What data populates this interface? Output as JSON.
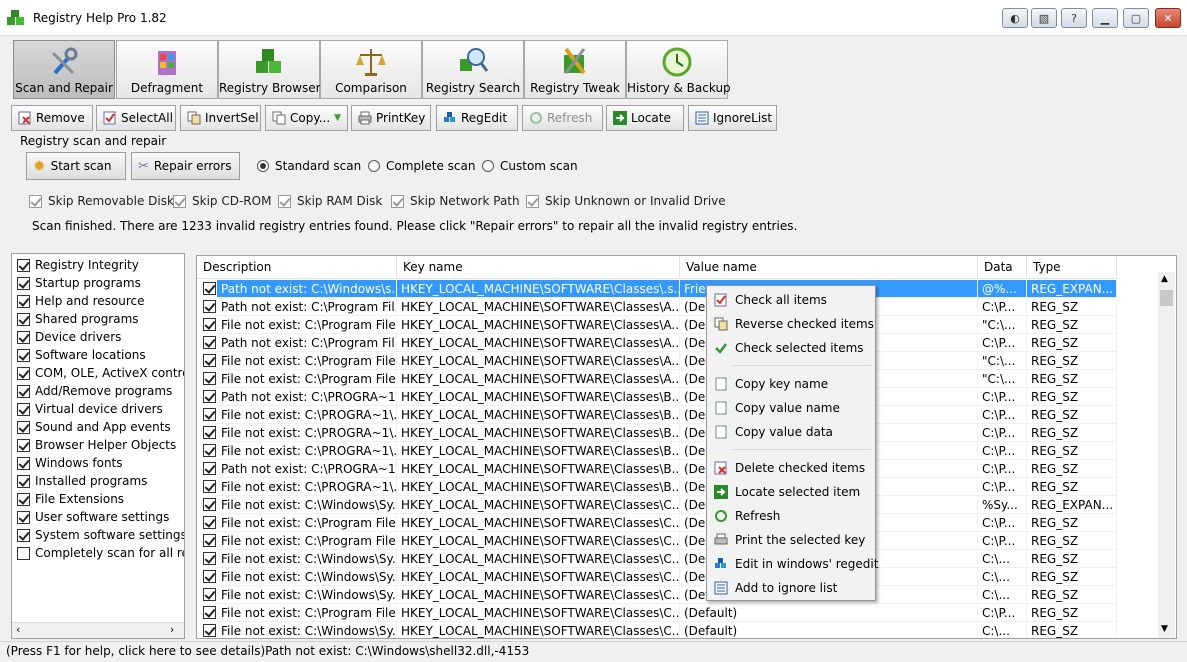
{
  "window": {
    "title": "Registry Help Pro 1.82"
  },
  "main_tabs": [
    {
      "label": "Scan and Repair",
      "icon": "scan-repair-icon",
      "active": true
    },
    {
      "label": "Defragment",
      "icon": "defragment-icon"
    },
    {
      "label": "Registry Browser",
      "icon": "registry-browser-icon"
    },
    {
      "label": "Comparison",
      "icon": "comparison-icon"
    },
    {
      "label": "Registry Search",
      "icon": "registry-search-icon"
    },
    {
      "label": "Registry Tweak",
      "icon": "registry-tweak-icon"
    },
    {
      "label": "History & Backup",
      "icon": "history-backup-icon"
    }
  ],
  "toolbar": {
    "remove": "Remove",
    "selectall": "SelectAll",
    "invertsel": "InvertSel",
    "copy": "Copy...",
    "printkey": "PrintKey",
    "regedit": "RegEdit",
    "refresh": "Refresh",
    "locate": "Locate",
    "ignorelist": "IgnoreList"
  },
  "scan": {
    "group_label": "Registry scan and repair",
    "start_label": "Start scan",
    "repair_label": "Repair errors",
    "modes": [
      "Standard scan",
      "Complete scan",
      "Custom scan"
    ],
    "selected_mode": "Standard scan",
    "skips": [
      "Skip Removable Disk",
      "Skip CD-ROM",
      "Skip RAM Disk",
      "Skip Network Path",
      "Skip Unknown or Invalid Drive"
    ],
    "status": "Scan finished. There are 1233 invalid registry entries found. Please click \"Repair errors\" to repair all the invalid registry entries."
  },
  "categories": [
    {
      "label": "Registry Integrity",
      "checked": true
    },
    {
      "label": "Startup programs",
      "checked": true
    },
    {
      "label": "Help and resource",
      "checked": true
    },
    {
      "label": "Shared programs",
      "checked": true
    },
    {
      "label": "Device drivers",
      "checked": true
    },
    {
      "label": "Software locations",
      "checked": true
    },
    {
      "label": "COM, OLE, ActiveX control",
      "checked": true
    },
    {
      "label": "Add/Remove programs",
      "checked": true
    },
    {
      "label": "Virtual device drivers",
      "checked": true
    },
    {
      "label": "Sound and App events",
      "checked": true
    },
    {
      "label": "Browser Helper Objects",
      "checked": true
    },
    {
      "label": "Windows fonts",
      "checked": true
    },
    {
      "label": "Installed programs",
      "checked": true
    },
    {
      "label": "File Extensions",
      "checked": true
    },
    {
      "label": "User software settings",
      "checked": true
    },
    {
      "label": "System software settings",
      "checked": true
    },
    {
      "label": "Completely scan for all regis",
      "checked": false
    }
  ],
  "grid": {
    "columns": [
      "Description",
      "Key name",
      "Value name",
      "Data",
      "Type"
    ],
    "rows": [
      [
        "Path not exist: C:\\Windows\\s...",
        "HKEY_LOCAL_MACHINE\\SOFTWARE\\Classes\\.s...",
        "Frie",
        "@%...",
        "REG_EXPAN..."
      ],
      [
        "Path not exist: C:\\Program Fil...",
        "HKEY_LOCAL_MACHINE\\SOFTWARE\\Classes\\A...",
        "(De",
        "C:\\P...",
        "REG_SZ"
      ],
      [
        "File not exist: C:\\Program Files...",
        "HKEY_LOCAL_MACHINE\\SOFTWARE\\Classes\\A...",
        "(De",
        "\"C:\\...",
        "REG_SZ"
      ],
      [
        "Path not exist: C:\\Program Fil...",
        "HKEY_LOCAL_MACHINE\\SOFTWARE\\Classes\\A...",
        "(De",
        "C:\\P...",
        "REG_SZ"
      ],
      [
        "File not exist: C:\\Program Files...",
        "HKEY_LOCAL_MACHINE\\SOFTWARE\\Classes\\A...",
        "(De",
        "\"C:\\...",
        "REG_SZ"
      ],
      [
        "File not exist: C:\\Program Files...",
        "HKEY_LOCAL_MACHINE\\SOFTWARE\\Classes\\A...",
        "(De",
        "\"C:\\...",
        "REG_SZ"
      ],
      [
        "Path not exist: C:\\PROGRA~1\\...",
        "HKEY_LOCAL_MACHINE\\SOFTWARE\\Classes\\B...",
        "(De",
        "C:\\P...",
        "REG_SZ"
      ],
      [
        "File not exist: C:\\PROGRA~1\\...",
        "HKEY_LOCAL_MACHINE\\SOFTWARE\\Classes\\B...",
        "(De",
        "C:\\P...",
        "REG_SZ"
      ],
      [
        "File not exist: C:\\PROGRA~1\\...",
        "HKEY_LOCAL_MACHINE\\SOFTWARE\\Classes\\B...",
        "(De",
        "C:\\P...",
        "REG_SZ"
      ],
      [
        "File not exist: C:\\PROGRA~1\\...",
        "HKEY_LOCAL_MACHINE\\SOFTWARE\\Classes\\B...",
        "(De",
        "C:\\P...",
        "REG_SZ"
      ],
      [
        "Path not exist: C:\\PROGRA~1\\...",
        "HKEY_LOCAL_MACHINE\\SOFTWARE\\Classes\\B...",
        "(De",
        "C:\\P...",
        "REG_SZ"
      ],
      [
        "File not exist: C:\\PROGRA~1\\...",
        "HKEY_LOCAL_MACHINE\\SOFTWARE\\Classes\\B...",
        "(De",
        "C:\\P...",
        "REG_SZ"
      ],
      [
        "File not exist: C:\\Windows\\Sy...",
        "HKEY_LOCAL_MACHINE\\SOFTWARE\\Classes\\C...",
        "(De",
        "%Sy...",
        "REG_EXPAN..."
      ],
      [
        "File not exist: C:\\Program Files...",
        "HKEY_LOCAL_MACHINE\\SOFTWARE\\Classes\\C...",
        "(De",
        "C:\\P...",
        "REG_SZ"
      ],
      [
        "File not exist: C:\\Program Files...",
        "HKEY_LOCAL_MACHINE\\SOFTWARE\\Classes\\C...",
        "(De",
        "C:\\P...",
        "REG_SZ"
      ],
      [
        "File not exist: C:\\Windows\\Sy...",
        "HKEY_LOCAL_MACHINE\\SOFTWARE\\Classes\\C...",
        "(De",
        "C:\\...",
        "REG_SZ"
      ],
      [
        "File not exist: C:\\Windows\\Sy...",
        "HKEY_LOCAL_MACHINE\\SOFTWARE\\Classes\\C...",
        "(De",
        "C:\\...",
        "REG_SZ"
      ],
      [
        "File not exist: C:\\Windows\\Sy...",
        "HKEY_LOCAL_MACHINE\\SOFTWARE\\Classes\\C...",
        "(Default)",
        "C:\\...",
        "REG_SZ"
      ],
      [
        "File not exist: C:\\Program Files...",
        "HKEY_LOCAL_MACHINE\\SOFTWARE\\Classes\\C...",
        "(Default)",
        "C:\\P...",
        "REG_SZ"
      ],
      [
        "File not exist: C:\\Windows\\Sy...",
        "HKEY_LOCAL_MACHINE\\SOFTWARE\\Classes\\C...",
        "(Default)",
        "C:\\...",
        "REG_SZ"
      ]
    ]
  },
  "context_menu": {
    "items": [
      {
        "label": "Check all items",
        "icon": "check-all-icon"
      },
      {
        "label": "Reverse checked items",
        "icon": "reverse-check-icon"
      },
      {
        "label": "Check selected items",
        "icon": "check-selected-icon"
      },
      {
        "label": "Copy key name",
        "icon": "copy-key-icon"
      },
      {
        "label": "Copy value name",
        "icon": "copy-value-icon"
      },
      {
        "label": "Copy value data",
        "icon": "copy-data-icon"
      },
      {
        "label": "Delete checked items",
        "icon": "delete-icon"
      },
      {
        "label": "Locate selected item",
        "icon": "locate-icon"
      },
      {
        "label": "Refresh",
        "icon": "refresh-icon"
      },
      {
        "label": "Print the selected key",
        "icon": "print-icon"
      },
      {
        "label": "Edit in windows' regedit",
        "icon": "regedit-icon"
      },
      {
        "label": "Add to ignore list",
        "icon": "ignore-list-icon"
      }
    ]
  },
  "statusbar": {
    "text": "(Press F1 for help, click here to see details)Path not exist: C:\\Windows\\shell32.dll,-4153"
  },
  "colors": {
    "selection": "#3399ff",
    "window_bg": "#f0f0f0"
  }
}
